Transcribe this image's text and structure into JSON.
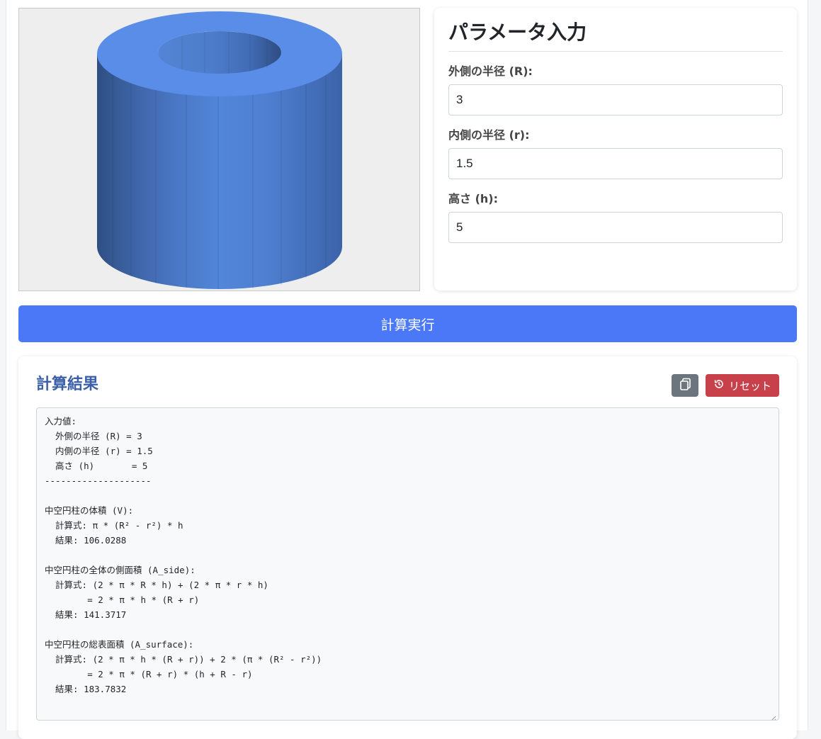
{
  "params": {
    "title": "パラメータ入力",
    "outer_radius": {
      "label": "外側の半径 (R):",
      "value": "3"
    },
    "inner_radius": {
      "label": "内側の半径 (r):",
      "value": "1.5"
    },
    "height": {
      "label": "高さ (h):",
      "value": "5"
    }
  },
  "actions": {
    "calculate_label": "計算実行"
  },
  "result": {
    "title": "計算結果",
    "reset_label": "リセット",
    "output": "入力値:\n  外側の半径 (R) = 3\n  内側の半径 (r) = 1.5\n  高さ (h)       = 5\n--------------------\n\n中空円柱の体積 (V):\n  計算式: π * (R² - r²) * h\n  結果: 106.0288\n\n中空円柱の全体の側面積 (A_side):\n  計算式: (2 * π * R * h) + (2 * π * r * h)\n        = 2 * π * h * (R + r)\n  結果: 141.3717\n\n中空円柱の総表面積 (A_surface):\n  計算式: (2 * π * h * (R + r)) + 2 * (π * (R² - r²))\n        = 2 * π * (R + r) * (h + R - r)\n  結果: 183.7832"
  },
  "colors": {
    "primary": "#4a78f7",
    "danger": "#c8414a",
    "secondary": "#6c757d",
    "accent_title": "#3b5fa8",
    "cylinder_top": "#5a8de8"
  },
  "icons": {
    "copy": "copy-icon",
    "reset": "history-icon"
  }
}
